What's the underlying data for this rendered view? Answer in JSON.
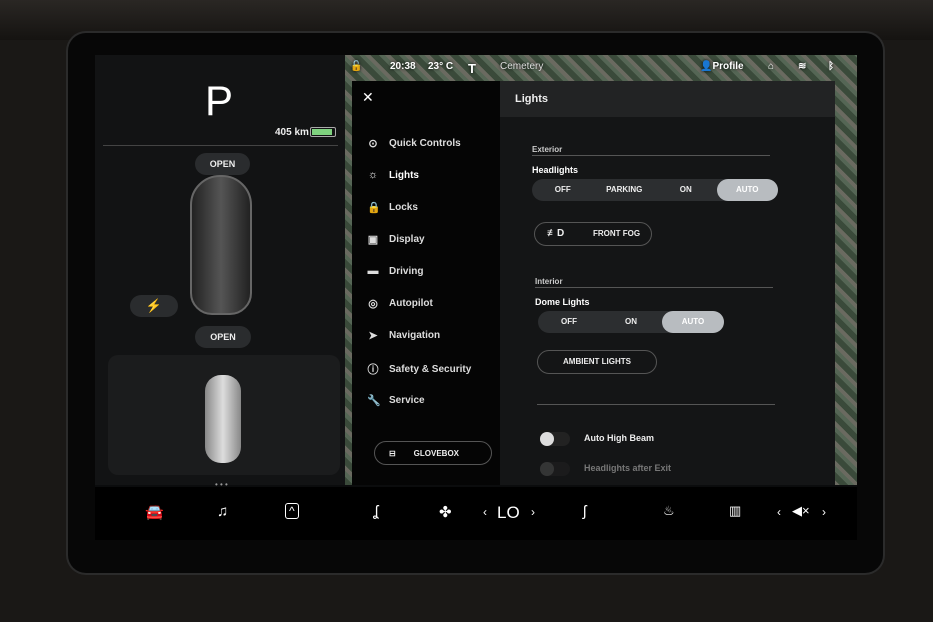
{
  "left_panel": {
    "gear": "P",
    "range": "405 km",
    "battery_level": 0.9,
    "frunk": "OPEN",
    "trunk": "OPEN",
    "charge_icon": "lightning-icon",
    "pages_dots": "• • •"
  },
  "status_bar": {
    "time": "20:38",
    "temperature": "23° C",
    "map_label": "Cemetery",
    "profile": "Profile"
  },
  "menu": {
    "close": "✕",
    "items": [
      {
        "label": "Quick Controls",
        "icon": "toggle-icon",
        "selected": false
      },
      {
        "label": "Lights",
        "icon": "sun-icon",
        "selected": true
      },
      {
        "label": "Locks",
        "icon": "lock-icon",
        "selected": false
      },
      {
        "label": "Display",
        "icon": "display-icon",
        "selected": false
      },
      {
        "label": "Driving",
        "icon": "car-icon",
        "selected": false
      },
      {
        "label": "Autopilot",
        "icon": "steering-wheel-icon",
        "selected": false
      },
      {
        "label": "Navigation",
        "icon": "navigation-arrow-icon",
        "selected": false
      },
      {
        "label": "Safety & Security",
        "icon": "alert-circle-icon",
        "selected": false
      },
      {
        "label": "Service",
        "icon": "wrench-icon",
        "selected": false
      }
    ],
    "glovebox": "GLOVEBOX"
  },
  "lights": {
    "title": "Lights",
    "exterior": "Exterior",
    "headlights_label": "Headlights",
    "headlights_options": [
      "OFF",
      "PARKING",
      "ON",
      "AUTO"
    ],
    "headlights_selected": "AUTO",
    "front_fog": "FRONT FOG",
    "interior": "Interior",
    "dome_label": "Dome Lights",
    "dome_options": [
      "OFF",
      "ON",
      "AUTO"
    ],
    "dome_selected": "AUTO",
    "ambient": "AMBIENT LIGHTS",
    "auto_high_beam": "Auto High Beam",
    "auto_high_beam_on": false,
    "headlights_after_exit": "Headlights after Exit",
    "headlights_after_exit_on": false
  },
  "dock": {
    "climate_temp": "LO",
    "prev": "‹",
    "next": "›"
  }
}
